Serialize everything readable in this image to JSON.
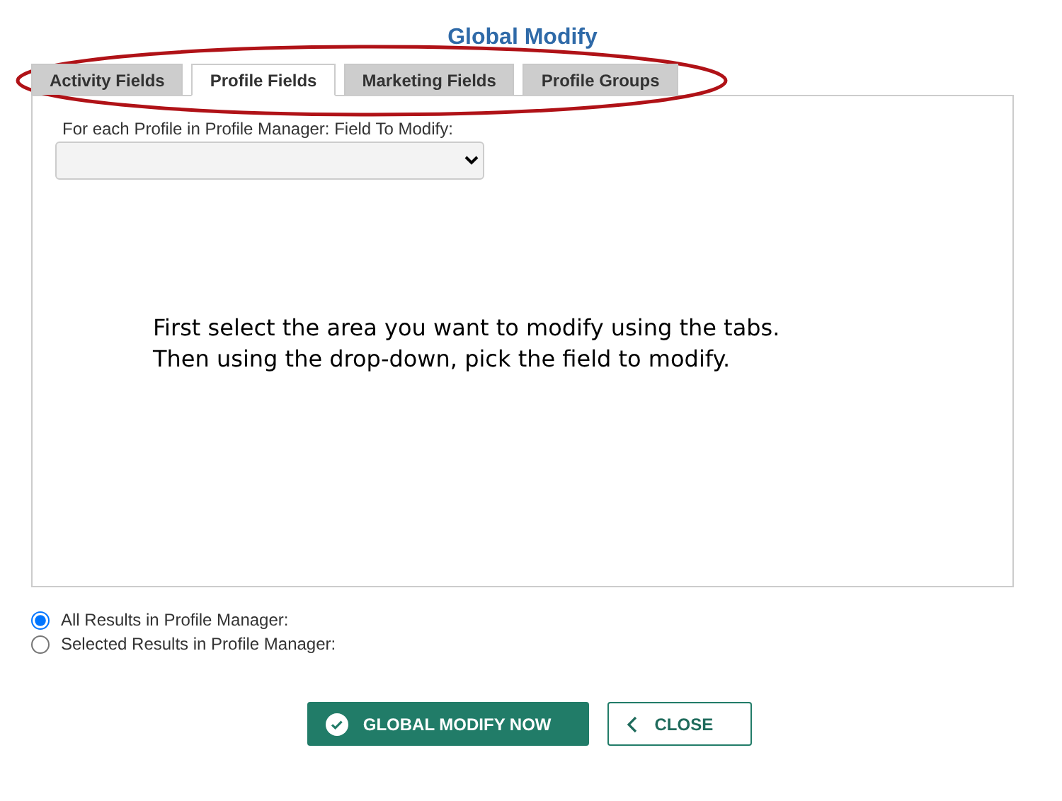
{
  "title": "Global Modify",
  "tabs": [
    {
      "label": "Activity Fields",
      "selected": false
    },
    {
      "label": "Profile Fields",
      "selected": true
    },
    {
      "label": "Marketing Fields",
      "selected": false
    },
    {
      "label": "Profile Groups",
      "selected": false
    }
  ],
  "field_label": "For each Profile in Profile Manager: Field To Modify:",
  "instructions": [
    "First select the area you want to modify using the tabs.",
    "Then using the drop-down, pick the field to modify."
  ],
  "scope": [
    {
      "label": "All Results in Profile Manager:",
      "selected": true
    },
    {
      "label": "Selected Results in Profile Manager:",
      "selected": false
    }
  ],
  "buttons": [
    {
      "label": "GLOBAL MODIFY NOW",
      "kind": "primary"
    },
    {
      "label": "CLOSE",
      "kind": "secondary"
    }
  ],
  "annotation": {
    "kind": "ellipse",
    "color": "#b01217"
  }
}
